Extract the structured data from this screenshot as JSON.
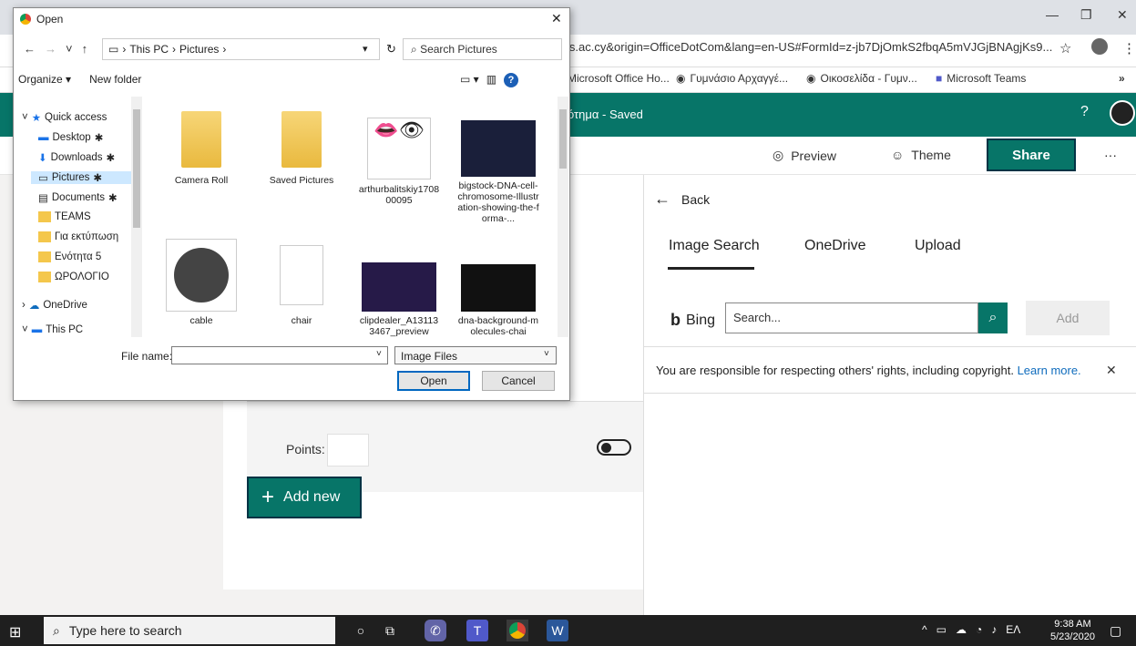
{
  "browser": {
    "url": "ls.ac.cy&origin=OfficeDotCom&lang=en-US#FormId=z-jb7DjOmkS2fbqA5mVJGjBNAgjKs9...",
    "bookmarks": [
      "Microsoft Office Ho...",
      "Γυμνάσιο Αρχαγγέ...",
      "Οικοσελίδα - Γυμν...",
      "Microsoft Teams"
    ],
    "more": "»"
  },
  "forms": {
    "title": "ότημα - Saved",
    "help": "?",
    "preview": "Preview",
    "theme": "Theme",
    "share": "Share",
    "more": "···",
    "points_label": "Points:",
    "add_new": "Add new"
  },
  "panel": {
    "back": "Back",
    "tabs": [
      "Image Search",
      "OneDrive",
      "Upload"
    ],
    "bing": "Bing",
    "search_placeholder": "Search...",
    "add": "Add",
    "notice": "You are responsible for respecting others' rights, including copyright.",
    "learn_more": "Learn more."
  },
  "dialog": {
    "title": "Open",
    "path": [
      "This PC",
      "Pictures"
    ],
    "search_placeholder": "Search Pictures",
    "organize": "Organize ▾",
    "new_folder": "New folder",
    "nav": [
      {
        "label": "Quick access",
        "icon": "star-icon"
      },
      {
        "label": "Desktop",
        "icon": "desktop-icon"
      },
      {
        "label": "Downloads",
        "icon": "download-icon"
      },
      {
        "label": "Pictures",
        "icon": "pictures-icon"
      },
      {
        "label": "Documents",
        "icon": "documents-icon"
      },
      {
        "label": "TEAMS",
        "icon": "folder-icon"
      },
      {
        "label": "Για εκτύπωση",
        "icon": "folder-icon"
      },
      {
        "label": "Ενότητα 5",
        "icon": "folder-icon"
      },
      {
        "label": "ΩΡΟΛΟΓΙΟ",
        "icon": "folder-icon"
      },
      {
        "label": "OneDrive",
        "icon": "cloud-icon"
      },
      {
        "label": "This PC",
        "icon": "pc-icon"
      }
    ],
    "files": [
      {
        "name": "Camera Roll"
      },
      {
        "name": "Saved Pictures"
      },
      {
        "name": "arthurbalitskiy170800095"
      },
      {
        "name": "bigstock-DNA-cell-chromosome-Illustration-showing-the-forma-..."
      },
      {
        "name": "cable"
      },
      {
        "name": "chair"
      },
      {
        "name": "clipdealer_A131133467_preview"
      },
      {
        "name": "dna-background-molecules-chai"
      }
    ],
    "file_name_label": "File name:",
    "file_type": "Image Files",
    "open": "Open",
    "cancel": "Cancel"
  },
  "taskbar": {
    "search": "Type here to search",
    "lang": "ΕΛ",
    "time": "9:38 AM",
    "date": "5/23/2020"
  }
}
